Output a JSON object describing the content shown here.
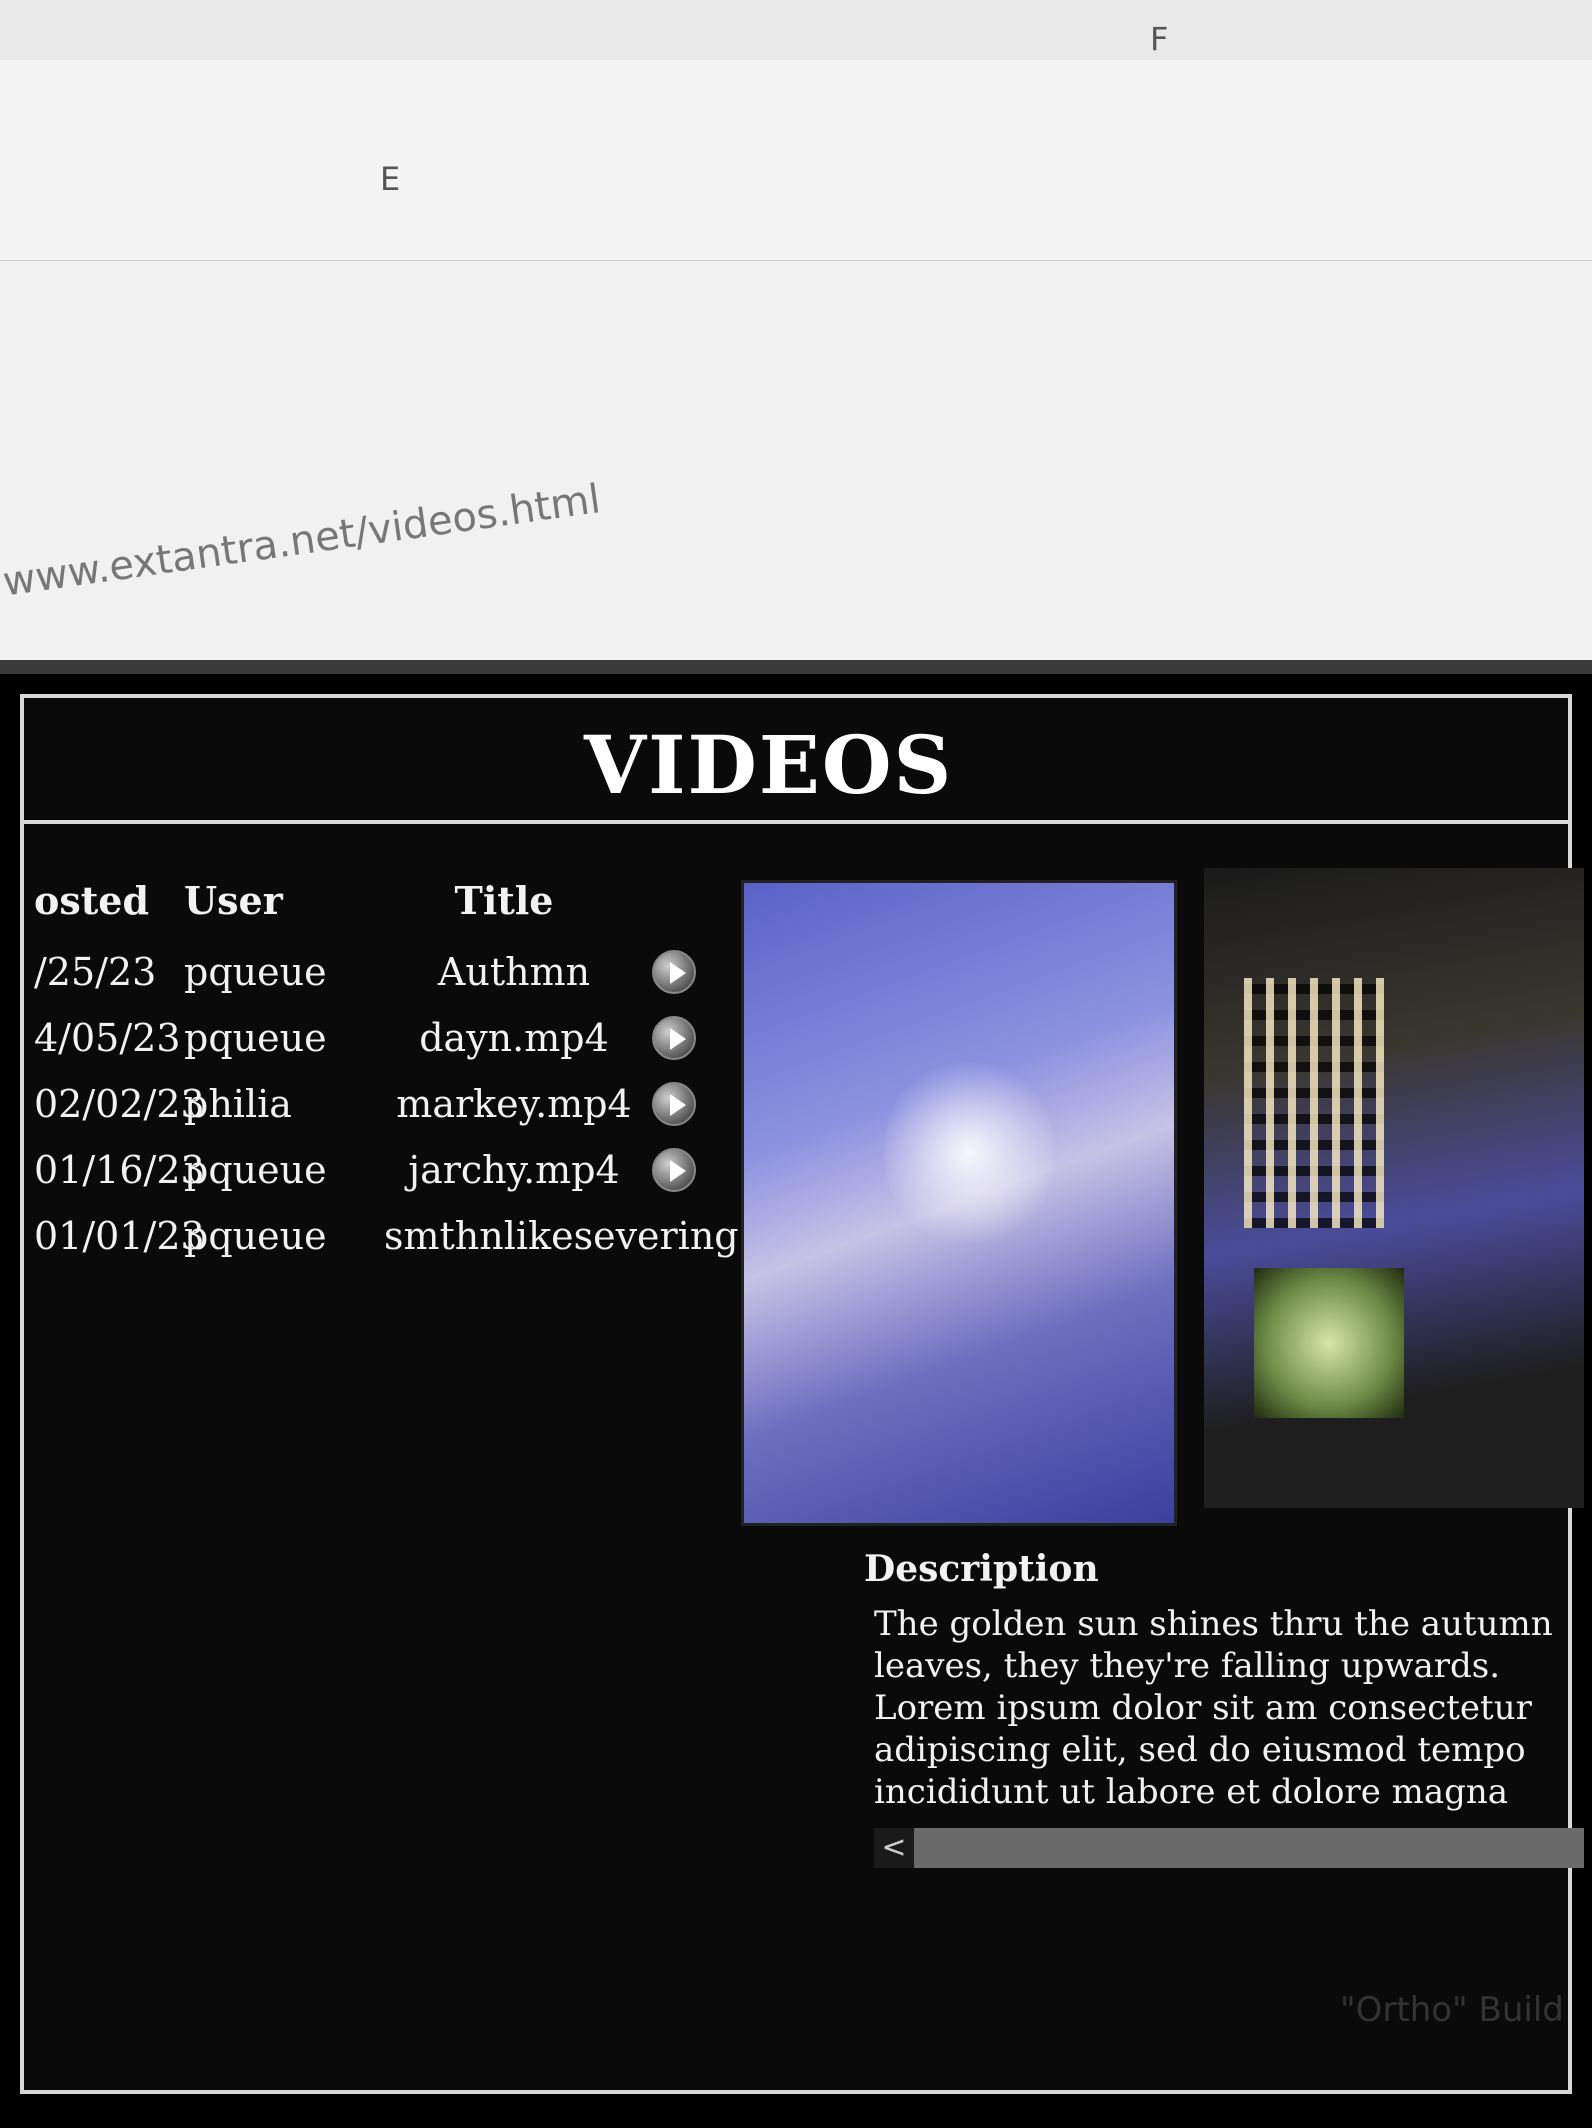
{
  "spreadsheet": {
    "column_e": "E",
    "column_f": "F"
  },
  "url": "www.extantra.net/videos.html",
  "page": {
    "title": "VIDEOS",
    "table": {
      "headers": {
        "posted": "osted",
        "user": "User",
        "title": "Title"
      },
      "rows": [
        {
          "posted": "/25/23",
          "user": "pqueue",
          "title": "Authmn"
        },
        {
          "posted": "4/05/23",
          "user": "pqueue",
          "title": "dayn.mp4"
        },
        {
          "posted": "02/02/23",
          "user": "philia",
          "title": "markey.mp4"
        },
        {
          "posted": "01/16/23",
          "user": "pqueue",
          "title": "jarchy.mp4"
        },
        {
          "posted": "01/01/23",
          "user": "pqueue",
          "title": "smthnlikesevering"
        }
      ]
    },
    "description_heading": "Description",
    "description_text": "The golden sun shines thru the autumn leaves, they they're falling upwards. Lorem ipsum dolor sit am consectetur adipiscing elit, sed do eiusmod tempo incididunt ut labore et dolore magna aliqua. Ut en minim veniam, quis nostrud exercitation ullamco",
    "scroll_left": "<"
  },
  "footer": "\"Ortho\" Build"
}
